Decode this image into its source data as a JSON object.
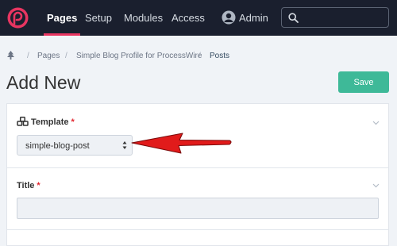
{
  "topbar": {
    "nav": [
      "Pages",
      "Setup",
      "Modules",
      "Access"
    ],
    "user": "Admin",
    "colors": {
      "bar": "#1a1f2e",
      "logo": "#e83561"
    }
  },
  "breadcrumb": {
    "home_icon": "tree-icon",
    "items": [
      "Pages",
      "Simple Blog Profile for ProcessWire",
      "Posts"
    ]
  },
  "page": {
    "title": "Add New",
    "save_label": "Save"
  },
  "form": {
    "template": {
      "label": "Template",
      "required": "*",
      "value": "simple-blog-post"
    },
    "title": {
      "label": "Title",
      "required": "*",
      "value": ""
    }
  },
  "annotation": {
    "arrow_color": "#e11b1b"
  }
}
